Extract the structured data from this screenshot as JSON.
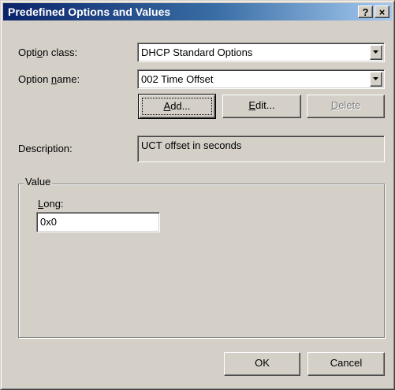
{
  "window": {
    "title": "Predefined Options and Values",
    "help_button": "?",
    "close_button": "×"
  },
  "option_class": {
    "label_pre": "Opti",
    "label_accel": "o",
    "label_post": "n class:",
    "value": "DHCP Standard Options"
  },
  "option_name": {
    "label_pre": "Option ",
    "label_accel": "n",
    "label_post": "ame:",
    "value": "002 Time Offset"
  },
  "buttons": {
    "add": {
      "accel": "A",
      "rest": "dd..."
    },
    "edit": {
      "accel": "E",
      "rest": "dit..."
    },
    "delete": {
      "accel": "D",
      "rest": "elete"
    },
    "ok": "OK",
    "cancel": "Cancel"
  },
  "description": {
    "label": "Description:",
    "value": "UCT offset in seconds"
  },
  "value_group": {
    "legend": "Value",
    "field_accel": "L",
    "field_rest": "ong:",
    "field_value": "0x0"
  },
  "icons": {
    "dropdown": "chevron-down-icon"
  }
}
